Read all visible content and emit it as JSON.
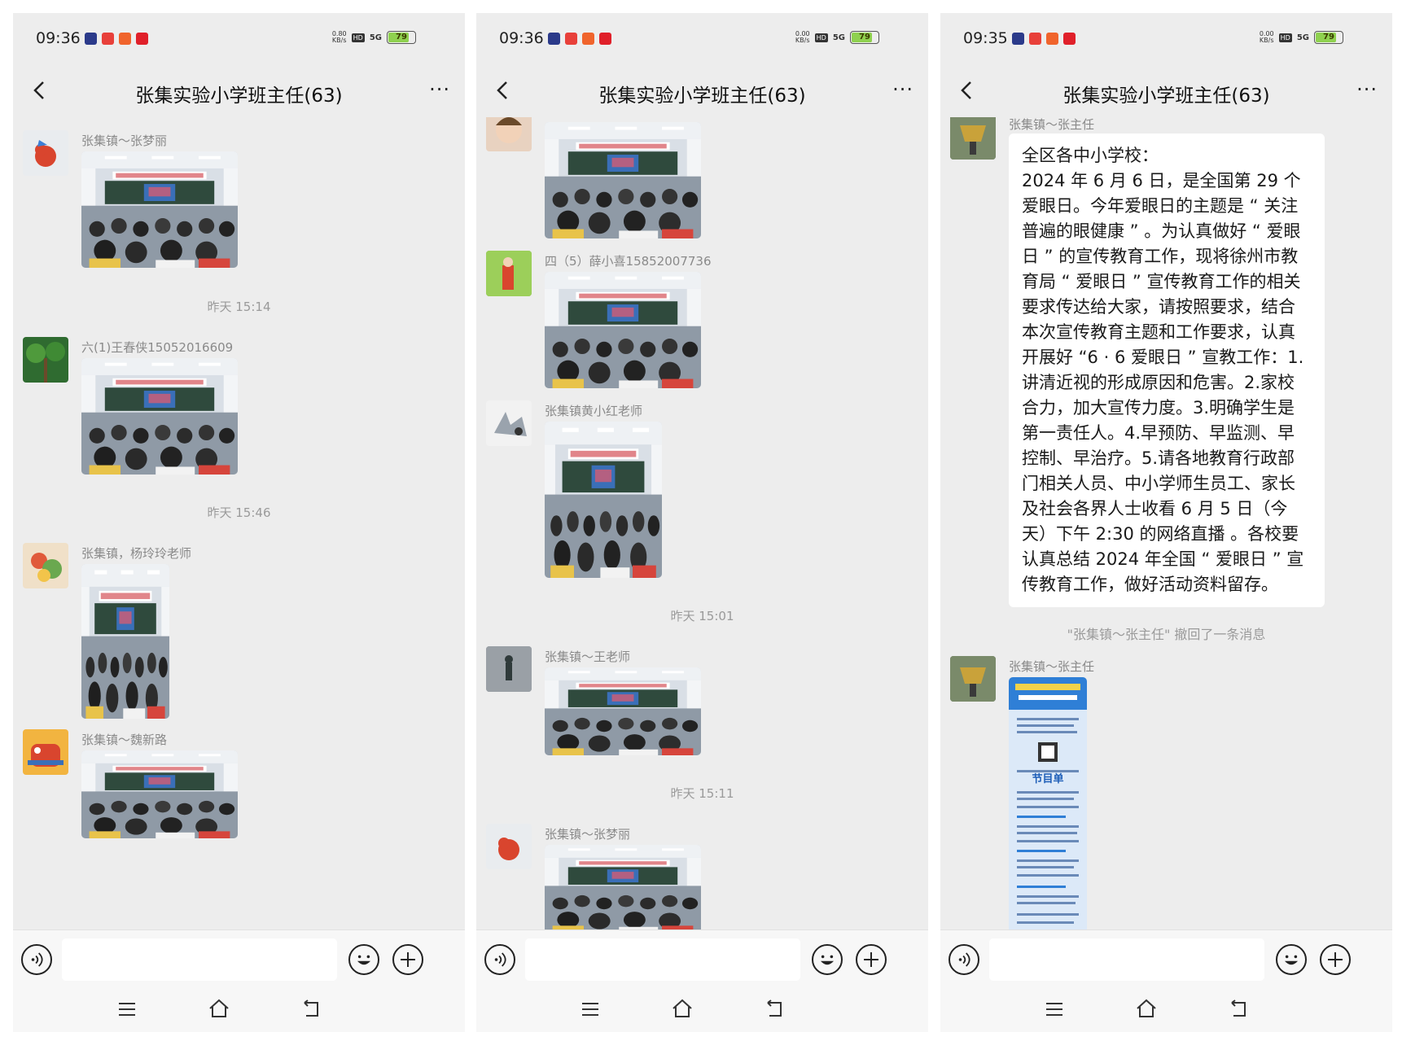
{
  "colors": {
    "panel_bg": "#ededed",
    "bubble_bg": "#ffffff",
    "sender_text": "#8a8a8a",
    "timestamp_text": "#9a9a9a",
    "battery_green": "#8fd14f",
    "status_icon_red": "#e8403a",
    "poster_blue": "#2f7fd6"
  },
  "panels": [
    {
      "status": {
        "time": "09:36",
        "net_speed": "0.80",
        "net_unit": "KB/s",
        "hd": "HD",
        "signal": "5G",
        "battery": "79"
      },
      "title": "张集实验小学班主任(63)",
      "messages": {
        "m1_sender": "张集镇～张梦丽",
        "t1": "昨天 15:14",
        "m2_sender": "六(1)王春侠15052016609",
        "t2": "昨天 15:46",
        "m3_sender": "张集镇，杨玲玲老师",
        "m4_sender": "张集镇～魏新路"
      }
    },
    {
      "status": {
        "time": "09:36",
        "net_speed": "0.00",
        "net_unit": "KB/s",
        "hd": "HD",
        "signal": "5G",
        "battery": "79"
      },
      "title": "张集实验小学班主任(63)",
      "messages": {
        "m2_sender": "四（5）薛小喜15852007736",
        "m3_sender": "张集镇黄小红老师",
        "t1": "昨天 15:01",
        "m4_sender": "张集镇～王老师",
        "t2": "昨天 15:11",
        "m5_sender": "张集镇～张梦丽"
      }
    },
    {
      "status": {
        "time": "09:35",
        "net_speed": "0.00",
        "net_unit": "KB/s",
        "hd": "HD",
        "signal": "5G",
        "battery": "79"
      },
      "title": "张集实验小学班主任(63)",
      "messages": {
        "m1_sender": "张集镇～张主任",
        "notice": "全区各中小学校：\n2024 年 6 月 6 日，是全国第 29 个爱眼日。今年爱眼日的主题是 “ 关注普遍的眼健康 ” 。为认真做好 “ 爱眼日 ” 的宣传教育工作，现将徐州市教育局 “ 爱眼日 ” 宣传教育工作的相关要求传达给大家，请按照要求，结合本次宣传教育主题和工作要求，认真开展好 “6 · 6 爱眼日 ” 宣教工作：1.讲清近视的形成原因和危害。2.家校合力，加大宣传力度。3.明确学生是第一责任人。4.早预防、早监测、早控制、早治疗。5.请各地教育行政部门相关人员、中小学师生员工、家长及社会各界人士收看 6 月 5 日（今天）下午 2:30 的网络直播 。各校要认真总结 2024 年全国 “ 爱眼日 ” 宣传教育工作，做好活动资料留存。",
        "recall": "\"张集镇～张主任\" 撤回了一条消息",
        "m2_sender": "张集镇～张主任",
        "poster_title": "节目单"
      }
    }
  ]
}
